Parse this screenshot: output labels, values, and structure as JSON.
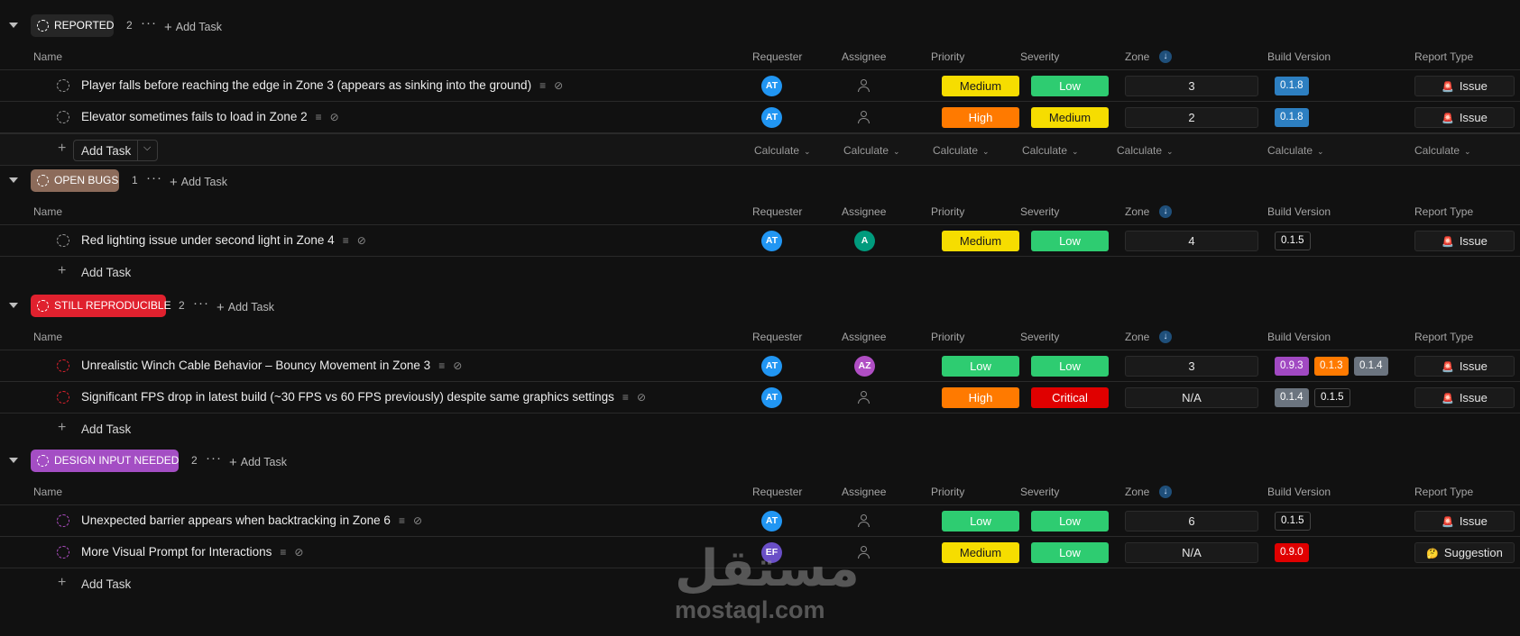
{
  "columns": {
    "name": "Name",
    "requester": "Requester",
    "assignee": "Assignee",
    "priority": "Priority",
    "severity": "Severity",
    "zone": "Zone",
    "build_version": "Build Version",
    "report_type": "Report Type",
    "sort_icon": "↓"
  },
  "add_task_label": "Add Task",
  "calculate_label": "Calculate",
  "colors": {
    "priority": {
      "Medium": "#f6dd00",
      "High": "#ff7a00",
      "Low": "#2ecc71"
    },
    "severity": {
      "Low": "#2ecc71",
      "Medium": "#f6dd00",
      "Critical": "#e00000"
    },
    "build": {
      "0.1.8": "#2d7fc1",
      "0.9.3": "#a149c2",
      "0.1.3": "#ff7a00",
      "0.1.4": "#6b747f",
      "0.9.0": "#e00000"
    },
    "groups": {
      "reported": "#262626",
      "open_bugs": "#8c6b5a",
      "still_reproducible": "#e0212e",
      "design_input_needed": "#a44ec4"
    }
  },
  "groups": [
    {
      "id": "reported",
      "label": "REPORTED",
      "count": "2",
      "tasks": [
        {
          "name": "Player falls before reaching the edge in Zone 3 (appears as sinking into the ground)",
          "requester": "AT",
          "assignee": "",
          "priority": "Medium",
          "severity": "Low",
          "zone": "3",
          "builds": [
            "0.1.8"
          ],
          "report_type": "Issue",
          "report_icon": "🚨"
        },
        {
          "name": "Elevator sometimes fails to load in Zone 2",
          "requester": "AT",
          "assignee": "",
          "priority": "High",
          "severity": "Medium",
          "zone": "2",
          "builds": [
            "0.1.8"
          ],
          "report_type": "Issue",
          "report_icon": "🚨"
        }
      ]
    },
    {
      "id": "open_bugs",
      "label": "OPEN BUGS",
      "count": "1",
      "tasks": [
        {
          "name": "Red lighting issue under second light in Zone 4",
          "requester": "AT",
          "assignee": "A",
          "priority": "Medium",
          "severity": "Low",
          "zone": "4",
          "builds": [
            "0.1.5"
          ],
          "report_type": "Issue",
          "report_icon": "🚨"
        }
      ]
    },
    {
      "id": "still_reproducible",
      "label": "STILL REPRODUCIBLE",
      "count": "2",
      "tasks": [
        {
          "name": "Unrealistic Winch Cable Behavior – Bouncy Movement in Zone 3",
          "requester": "AT",
          "assignee": "AZ",
          "priority": "Low",
          "severity": "Low",
          "zone": "3",
          "builds": [
            "0.9.3",
            "0.1.3",
            "0.1.4"
          ],
          "report_type": "Issue",
          "report_icon": "🚨"
        },
        {
          "name": "Significant FPS drop in latest build (~30 FPS vs 60 FPS previously) despite same graphics settings",
          "requester": "AT",
          "assignee": "",
          "priority": "High",
          "severity": "Critical",
          "zone": "N/A",
          "builds": [
            "0.1.4",
            "0.1.5"
          ],
          "report_type": "Issue",
          "report_icon": "🚨"
        }
      ]
    },
    {
      "id": "design_input_needed",
      "label": "DESIGN INPUT NEEDED",
      "count": "2",
      "tasks": [
        {
          "name": "Unexpected barrier appears when backtracking in Zone 6",
          "requester": "AT",
          "assignee": "",
          "priority": "Low",
          "severity": "Low",
          "zone": "6",
          "builds": [
            "0.1.5"
          ],
          "report_type": "Issue",
          "report_icon": "🚨"
        },
        {
          "name": "More Visual Prompt for Interactions",
          "requester": "EF",
          "assignee": "",
          "priority": "Medium",
          "severity": "Low",
          "zone": "N/A",
          "builds": [
            "0.9.0"
          ],
          "report_type": "Suggestion",
          "report_icon": "🤔"
        }
      ]
    }
  ],
  "watermark": {
    "arabic": "مستقل",
    "latin": "mostaql.com"
  }
}
